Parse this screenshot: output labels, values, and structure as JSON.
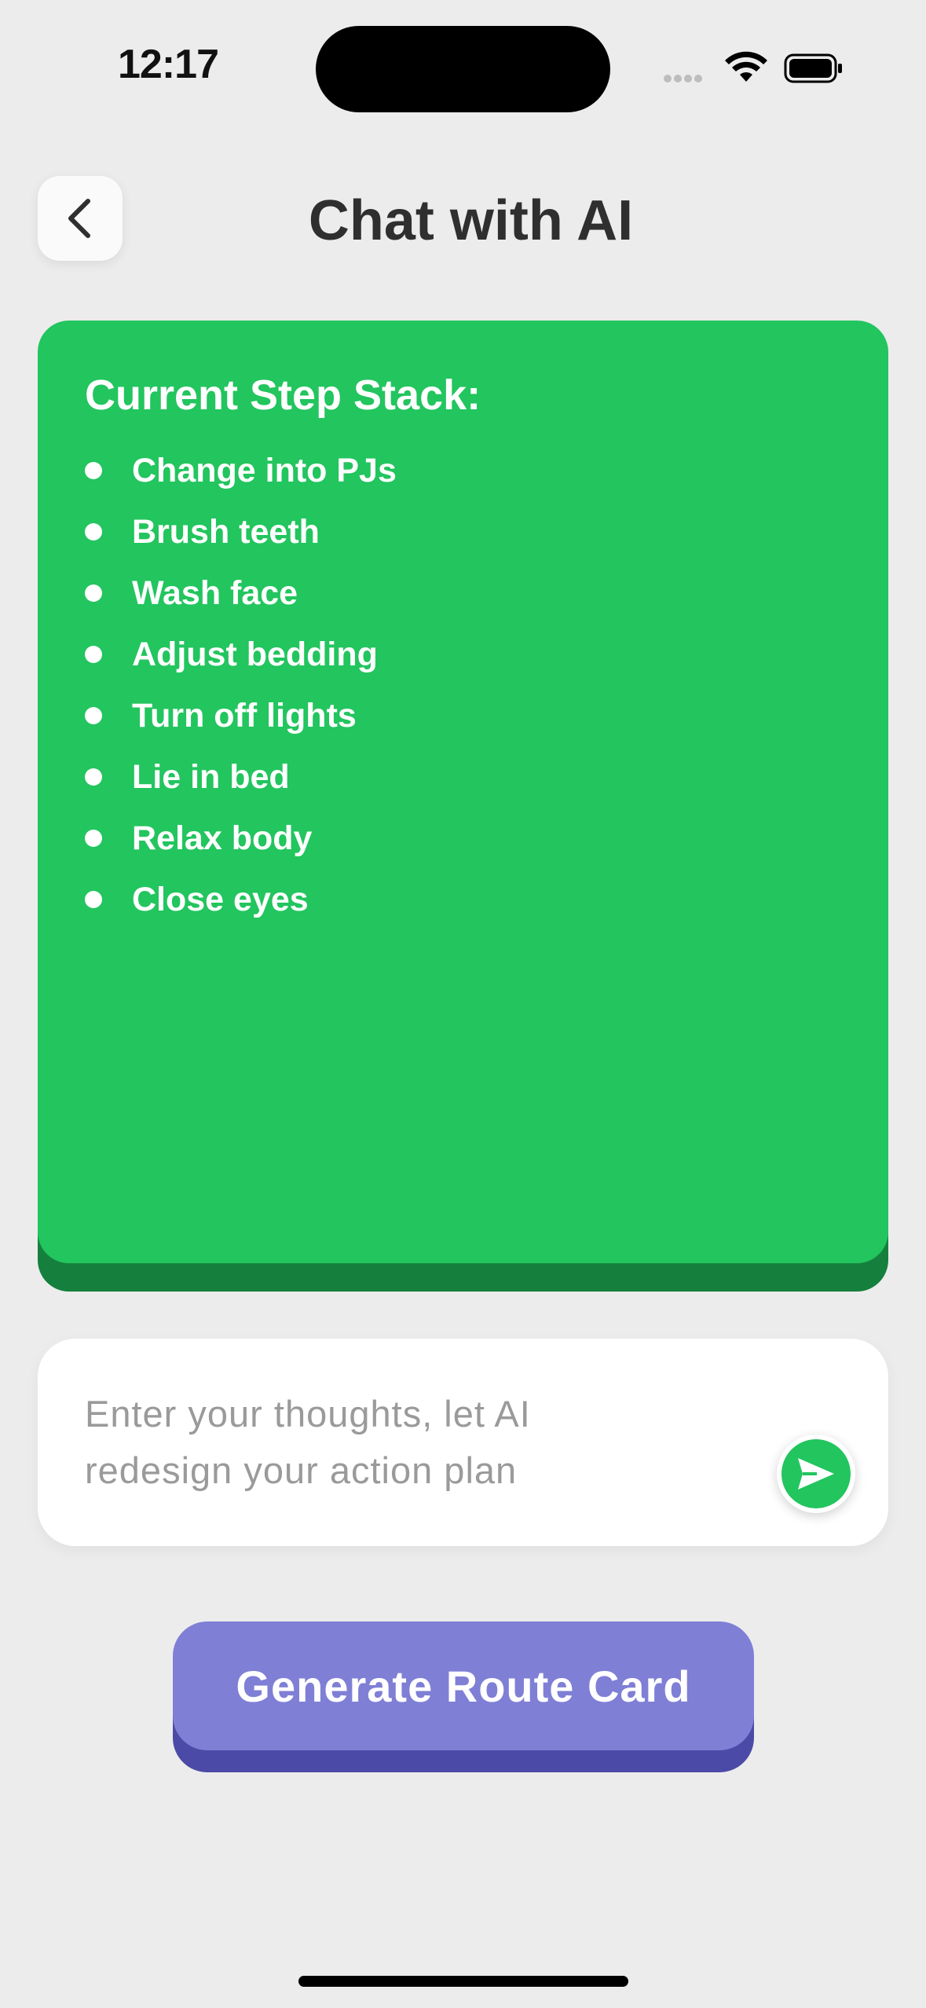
{
  "status_bar": {
    "time": "12:17"
  },
  "header": {
    "back_icon": "chevron-left-icon",
    "title": "Chat with AI"
  },
  "step_card": {
    "title": "Current Step Stack:",
    "steps": [
      "Change into PJs",
      "Brush teeth",
      "Wash face",
      "Adjust bedding",
      "Turn off lights",
      "Lie in bed",
      "Relax body",
      "Close eyes"
    ],
    "color": "#22c55e"
  },
  "chat_input": {
    "placeholder": "Enter your thoughts, let AI redesign your action plan",
    "send_icon": "send-icon"
  },
  "actions": {
    "generate_label": "Generate Route Card",
    "color": "#7f7fd6"
  }
}
